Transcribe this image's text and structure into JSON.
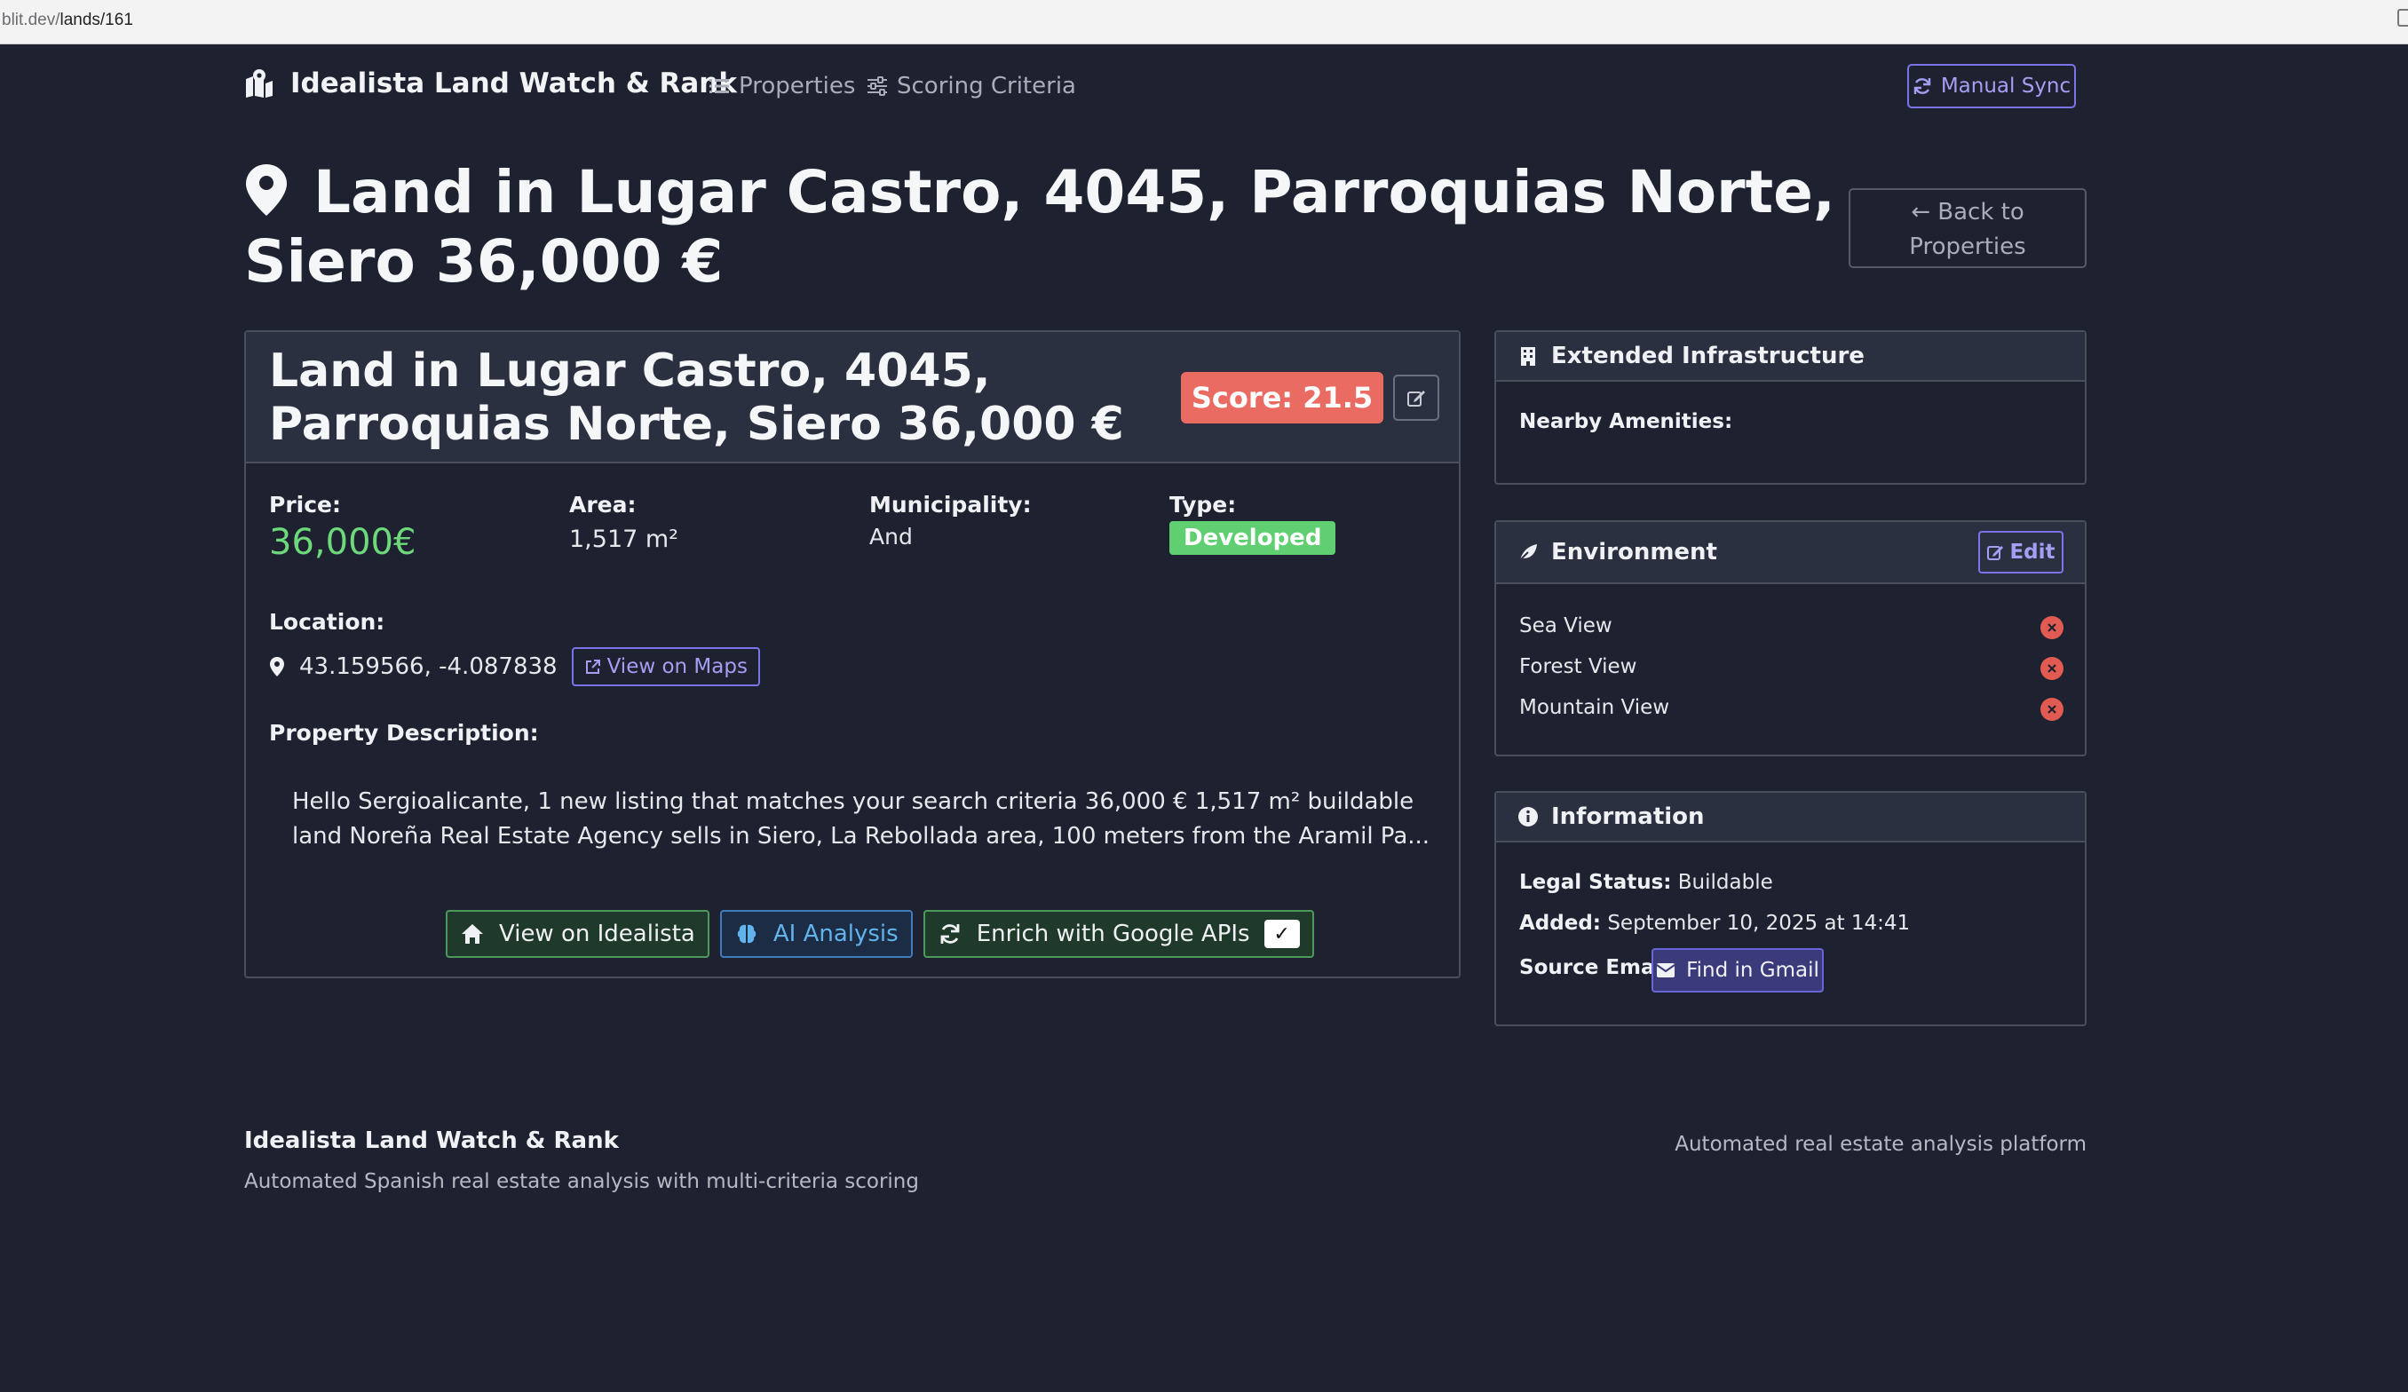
{
  "browser": {
    "url_dim": "blit.dev/",
    "url_path": "lands/161"
  },
  "navbar": {
    "brand": "Idealista Land Watch & Rank",
    "links": [
      {
        "label": "Properties",
        "icon": "list-icon"
      },
      {
        "label": "Scoring Criteria",
        "icon": "sliders-icon"
      }
    ],
    "sync_label": "Manual Sync"
  },
  "page": {
    "title": "Land in Lugar Castro, 4045, Parroquias Norte, Siero 36,000 €",
    "back_label": "Back to Properties"
  },
  "property": {
    "card_title": "Land in Lugar Castro, 4045, Parroquias Norte, Siero 36,000 €",
    "score": "Score: 21.5",
    "price_label": "Price:",
    "price": "36,000€",
    "area_label": "Area:",
    "area": "1,517 m²",
    "municipality_label": "Municipality:",
    "municipality": "And",
    "type_label": "Type:",
    "type": "Developed",
    "location_label": "Location:",
    "coordinates": "43.159566, -4.087838",
    "maps_label": "View on Maps",
    "description_label": "Property Description:",
    "description": "Hello Sergioalicante, 1 new listing that matches your search criteria 36,000 € 1,517 m² buildable land Noreña Real Estate Agency sells in Siero, La Rebollada area, 100 meters from the Aramil Pa...",
    "actions": {
      "idealista": "View on Idealista",
      "ai": "AI Analysis",
      "enrich": "Enrich with Google APIs",
      "enrich_check": "✓"
    }
  },
  "infrastructure": {
    "title": "Extended Infrastructure",
    "amenities_label": "Nearby Amenities:"
  },
  "environment": {
    "title": "Environment",
    "edit_label": "Edit",
    "items": [
      "Sea View",
      "Forest View",
      "Mountain View"
    ]
  },
  "information": {
    "title": "Information",
    "legal_label": "Legal Status:",
    "legal_value": "Buildable",
    "added_label": "Added:",
    "added_value": "September 10, 2025 at 14:41",
    "email_label": "Source Email:",
    "gmail_label": "Find in Gmail"
  },
  "footer": {
    "title": "Idealista Land Watch & Rank",
    "subtitle": "Automated Spanish real estate analysis with multi-criteria scoring",
    "right": "Automated real estate analysis platform"
  },
  "colors": {
    "accent": "#7c73e8",
    "score": "#ea6b62",
    "price": "#6dd97b",
    "badge": "#5fcf72",
    "background": "#1e2230"
  }
}
